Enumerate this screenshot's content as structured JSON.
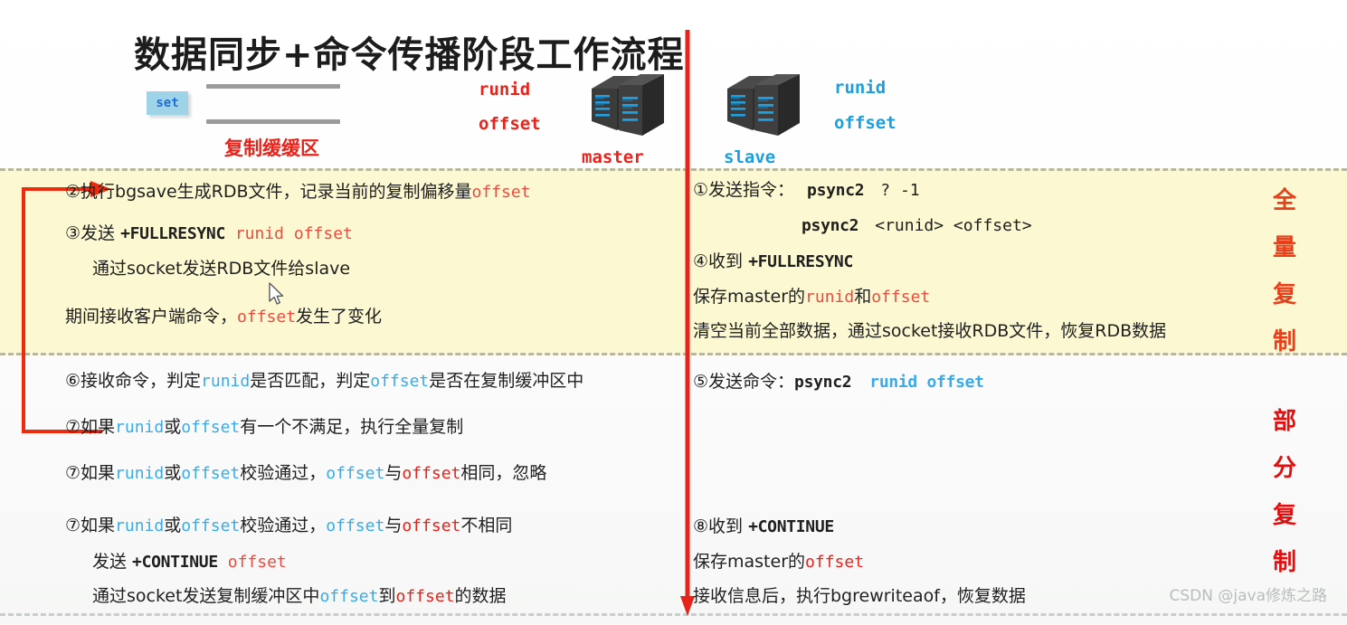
{
  "title": "数据同步+命令传播阶段工作流程",
  "header": {
    "set_chip": "set",
    "buffer_label": "复制缓缓区",
    "master": {
      "name": "master",
      "runid": "runid",
      "offset": "offset"
    },
    "slave": {
      "name": "slave",
      "runid": "runid",
      "offset": "offset"
    }
  },
  "colors": {
    "red": "#e8231b",
    "red_soft": "#ef4a3f",
    "blue": "#3aaae8",
    "blue_label": "#1a9fe0",
    "band_yellow": "#fbf8d2",
    "dashed_border": "#b9b6a4",
    "set_chip_bg": "#9fd4e8",
    "set_chip_text": "#1f6fd0",
    "side_full": "#e8401b",
    "side_partial": "#e01010"
  },
  "left_column": {
    "full": {
      "r1": {
        "a": "②执行bgsave生成RDB文件，记录当前的复制偏移量",
        "b": "offset"
      },
      "r2": {
        "a": "③发送 ",
        "b": "+FULLRESYNC",
        "c": " runid offset"
      },
      "r3": {
        "a": "通过socket发送RDB文件给slave"
      },
      "r4": {
        "a": "期间接收客户端命令，",
        "b": "offset",
        "c": "发生了变化"
      }
    },
    "partial": {
      "r6": {
        "a": "⑥接收命令，判定",
        "b": "runid",
        "c": "是否匹配，判定",
        "d": "offset",
        "e": "是否在复制缓冲区中"
      },
      "r7a": {
        "a": "⑦如果",
        "b": "runid",
        "c": "或",
        "d": "offset",
        "e": "有一个不满足，执行全量复制"
      },
      "r7b": {
        "a": "⑦如果",
        "b": "runid",
        "c": "或",
        "d": "offset",
        "e": "校验通过，",
        "f": "offset",
        "g": "与",
        "h": "offset",
        "i": "相同，忽略"
      },
      "r7c": {
        "a": "⑦如果",
        "b": "runid",
        "c": "或",
        "d": "offset",
        "e": "校验通过，",
        "f": "offset",
        "g": "与",
        "h": "offset",
        "i": "不相同"
      },
      "r7d": {
        "a": "发送 ",
        "b": "+CONTINUE",
        "c": " offset"
      },
      "r7e": {
        "a": "通过socket发送复制缓冲区中",
        "b": "offset",
        "c": "到",
        "d": "offset",
        "e": "的数据"
      }
    }
  },
  "right_column": {
    "full": {
      "r1": {
        "a": "①发送指令：",
        "b": "psync2",
        "c": "? -1"
      },
      "r2": {
        "b": "psync2",
        "c": "<runid> <offset>"
      },
      "r4": {
        "a": "④收到 ",
        "b": "+FULLRESYNC"
      },
      "r5": {
        "a": "保存master的",
        "b": "runid",
        "c": "和",
        "d": "offset"
      },
      "r6": {
        "a": "清空当前全部数据，通过socket接收RDB文件，恢复RDB数据"
      }
    },
    "partial": {
      "r5": {
        "a": "⑤发送命令：",
        "b": "psync2",
        "c": "runid offset"
      },
      "r8": {
        "a": "⑧收到 ",
        "b": "+CONTINUE"
      },
      "r9": {
        "a": "保存master的",
        "b": "offset"
      },
      "r10": {
        "a": "接收信息后，执行bgrewriteaof，恢复数据"
      }
    }
  },
  "side_labels": {
    "full": [
      "全",
      "量",
      "复",
      "制"
    ],
    "partial": [
      "部",
      "分",
      "复",
      "制"
    ]
  },
  "watermark": "CSDN @java修炼之路"
}
